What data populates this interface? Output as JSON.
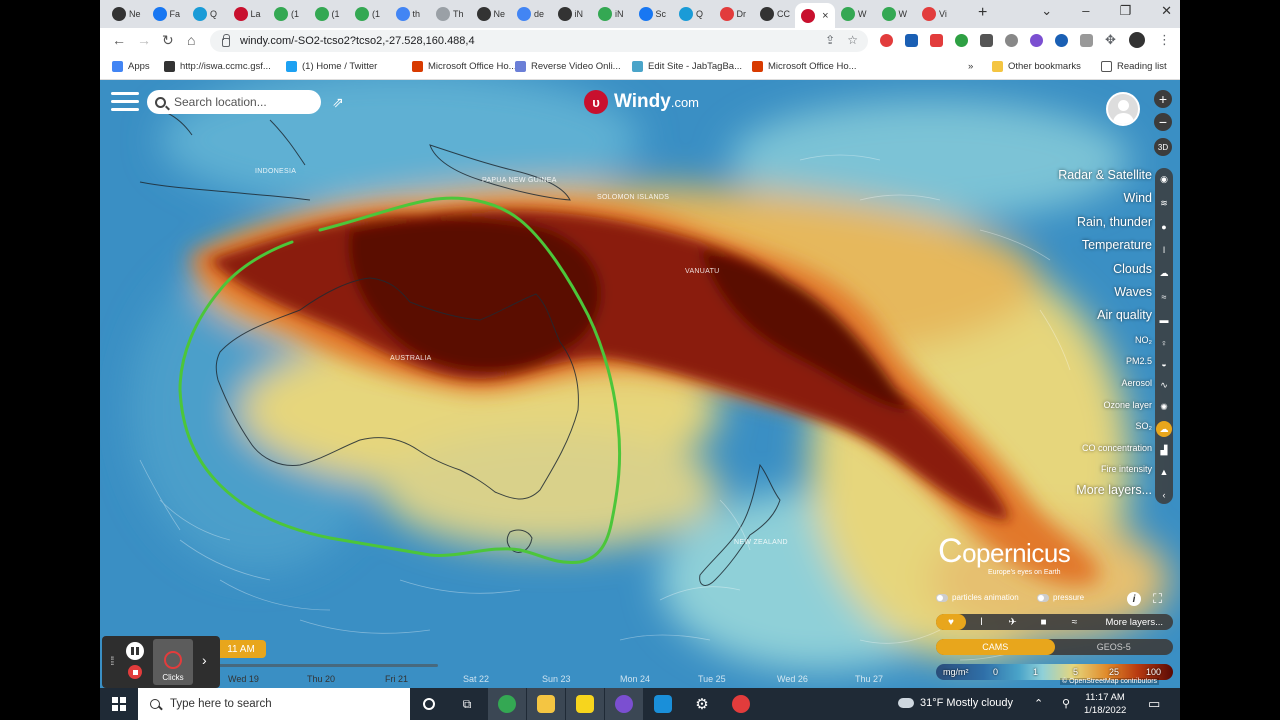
{
  "browser": {
    "tabs": [
      {
        "label": "Ne",
        "icon": "github-icon",
        "color": "#333333"
      },
      {
        "label": "Fa",
        "icon": "facebook-icon",
        "color": "#1877f2"
      },
      {
        "label": "Q",
        "icon": "quora-icon",
        "color": "#1a9bd7"
      },
      {
        "label": "La",
        "icon": "news-icon",
        "color": "#c8102e"
      },
      {
        "label": "(1",
        "icon": "chrome-icon",
        "color": "#34a853"
      },
      {
        "label": "(1",
        "icon": "chrome-icon",
        "color": "#34a853"
      },
      {
        "label": "(1",
        "icon": "chrome-icon",
        "color": "#34a853"
      },
      {
        "label": "th",
        "icon": "google-icon",
        "color": "#4285f4"
      },
      {
        "label": "Th",
        "icon": "page-icon",
        "color": "#9aa0a6"
      },
      {
        "label": "Ne",
        "icon": "github-icon",
        "color": "#333333"
      },
      {
        "label": "de",
        "icon": "google-icon",
        "color": "#4285f4"
      },
      {
        "label": "iN",
        "icon": "app-icon",
        "color": "#333333"
      },
      {
        "label": "iN",
        "icon": "chrome-icon",
        "color": "#34a853"
      },
      {
        "label": "Sc",
        "icon": "facebook-icon",
        "color": "#1877f2"
      },
      {
        "label": "Q",
        "icon": "quora-icon",
        "color": "#1a9bd7"
      },
      {
        "label": "Dr",
        "icon": "app-icon",
        "color": "#e23c3c"
      },
      {
        "label": "CC",
        "icon": "github-icon",
        "color": "#333333"
      },
      {
        "label": "",
        "icon": "windy-icon",
        "color": "#c8102e",
        "active": true
      },
      {
        "label": "W",
        "icon": "chrome-icon",
        "color": "#34a853"
      },
      {
        "label": "W",
        "icon": "chrome-icon",
        "color": "#34a853"
      },
      {
        "label": "Vi",
        "icon": "video-icon",
        "color": "#e23c3c"
      }
    ],
    "url": "windy.com/-SO2-tcso2?tcso2,-27.528,160.488,4",
    "bookmarks": [
      {
        "label": "Apps",
        "color": "#4285f4"
      },
      {
        "label": "http://iswa.ccmc.gsf...",
        "color": "#333333"
      },
      {
        "label": "(1) Home / Twitter",
        "color": "#1da1f2"
      },
      {
        "label": "Microsoft Office Ho...",
        "color": "#d83b01"
      },
      {
        "label": "Reverse Video Onli...",
        "color": "#6b7fd7"
      },
      {
        "label": "Edit Site - JabTagBa...",
        "color": "#4aa4c9"
      },
      {
        "label": "Microsoft Office Ho...",
        "color": "#d83b01"
      }
    ],
    "bookmarks_more": "»",
    "other_bookmarks": "Other bookmarks",
    "reading_list": "Reading list"
  },
  "map": {
    "search_placeholder": "Search location...",
    "logo": "Windy",
    "logo_suffix": ".com",
    "zoom_in": "+",
    "zoom_out": "−",
    "three_d": "3D",
    "place_labels": [
      {
        "text": "INDONESIA"
      },
      {
        "text": "PAPUA NEW GUINEA"
      },
      {
        "text": "SOLOMON ISLANDS"
      },
      {
        "text": "VANUATU"
      },
      {
        "text": "AUSTRALIA"
      },
      {
        "text": "NEW ZEALAND"
      }
    ],
    "layers": [
      {
        "label": "Radar & Satellite",
        "icon": "radar-icon",
        "small": false
      },
      {
        "label": "Wind",
        "icon": "wind-icon",
        "small": false
      },
      {
        "label": "Rain, thunder",
        "icon": "rain-icon",
        "small": false
      },
      {
        "label": "Temperature",
        "icon": "thermometer-icon",
        "small": false
      },
      {
        "label": "Clouds",
        "icon": "cloud-icon",
        "small": false
      },
      {
        "label": "Waves",
        "icon": "waves-icon",
        "small": false
      },
      {
        "label": "Air quality",
        "icon": "car-icon",
        "small": false
      },
      {
        "label": "NO₂",
        "icon": "no2-icon",
        "small": true
      },
      {
        "label": "PM2.5",
        "icon": "pm25-icon",
        "small": true
      },
      {
        "label": "Aerosol",
        "icon": "aerosol-icon",
        "small": true
      },
      {
        "label": "Ozone layer",
        "icon": "ozone-icon",
        "small": true
      },
      {
        "label": "SO₂",
        "icon": "so2-icon",
        "small": true,
        "selected": true
      },
      {
        "label": "CO concentration",
        "icon": "co-icon",
        "small": true
      },
      {
        "label": "Fire intensity",
        "icon": "fire-icon",
        "small": true
      },
      {
        "label": "More layers...",
        "icon": "chevron-left-icon",
        "small": false
      }
    ],
    "copernicus_name": "opernicus",
    "copernicus_sub": "Europe's eyes on Earth",
    "particles_label": "particles animation",
    "pressure_label": "pressure",
    "overlay_more": "More layers...",
    "models": [
      {
        "label": "CAMS",
        "active": true
      },
      {
        "label": "GEOS-5",
        "active": false
      }
    ],
    "legend": {
      "unit": "mg/m²",
      "ticks": [
        "0",
        "1",
        "5",
        "25",
        "100"
      ]
    },
    "credit": "© OpenStreetMap contributors",
    "timeline": {
      "current_time": "11 AM",
      "days": [
        "Wed 19",
        "Thu 20",
        "Fri 21",
        "Sat 22",
        "Sun 23",
        "Mon 24",
        "Tue 25",
        "Wed 26",
        "Thu 27"
      ],
      "clicks_label": "Clicks"
    },
    "accent_color": "#e8a61c",
    "annotation_color": "#4cc63a"
  },
  "taskbar": {
    "search_placeholder": "Type here to search",
    "weather": "31°F  Mostly cloudy",
    "time": "11:17 AM",
    "date": "1/18/2022"
  }
}
